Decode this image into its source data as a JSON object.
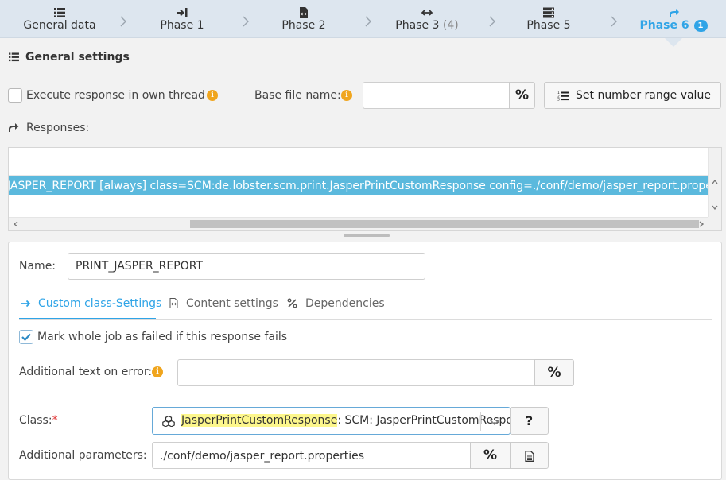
{
  "wizard": {
    "steps": [
      {
        "label": "General data",
        "icon": "list-icon"
      },
      {
        "label": "Phase 1",
        "icon": "sign-in-icon"
      },
      {
        "label": "Phase 2",
        "icon": "file-code-icon"
      },
      {
        "label": "Phase 3",
        "count": "(4)",
        "icon": "arrows-horizontal-icon"
      },
      {
        "label": "Phase 5",
        "icon": "server-icon"
      },
      {
        "label": "Phase 6",
        "badge": "1",
        "icon": "share-icon"
      }
    ],
    "active_step": "Phase 6"
  },
  "general_settings": {
    "title": "General settings",
    "execute_thread_label": "Execute response in own thread",
    "execute_thread_checked": false,
    "base_file_label": "Base file name:",
    "base_file_value": "",
    "percent_symbol": "%",
    "set_number_range_label": "Set number range value",
    "responses_label": "Responses:"
  },
  "responses": {
    "rows": [
      "JASPER_REPORT [always] class=SCM:de.lobster.scm.print.JasperPrintCustomResponse config=./conf/demo/jasper_report.properties"
    ]
  },
  "detail": {
    "name_label": "Name:",
    "name_value": "PRINT_JASPER_REPORT",
    "tabs": [
      {
        "label": "Custom class-Settings",
        "icon": "arrow-right-icon",
        "active": true
      },
      {
        "label": "Content settings",
        "icon": "file-code-icon",
        "active": false
      },
      {
        "label": "Dependencies",
        "icon": "percent-icon",
        "active": false
      }
    ],
    "mark_failed_label": "Mark whole job as failed if this response fails",
    "mark_failed_checked": true,
    "additional_text_label": "Additional text on error:",
    "additional_text_value": "",
    "class_label": "Class:",
    "required_mark": "*",
    "class_value_highlight": "JasperPrintCustomResponse",
    "class_value_rest": ": SCM: JasperPrintCustomResponse",
    "help_symbol": "?",
    "additional_params_label": "Additional parameters:",
    "additional_params_value": "./conf/demo/jasper_report.properties"
  },
  "colors": {
    "accent": "#2fa4e7",
    "selection": "#5bb9dd",
    "info": "#f0a51d",
    "required": "#e23b3b",
    "highlight": "#fdf78c"
  }
}
